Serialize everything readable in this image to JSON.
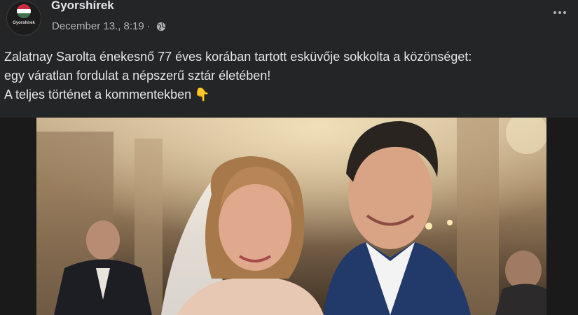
{
  "page": {
    "name": "Gyorshírek",
    "avatar_label": "Gyorshirek"
  },
  "post_meta": {
    "date": "December 13., 8:19",
    "separator": "·",
    "visibility_icon": "globe-icon"
  },
  "menu": {
    "icon": "more-options-icon"
  },
  "post": {
    "lines": [
      "Zalatnay Sarolta énekesnő 77 éves korában tartott esküvője sokkolta a közönséget:",
      "egy váratlan fordulat a népszerű sztár életében!",
      "A teljes történet a kommentekben"
    ],
    "emoji": "👇"
  },
  "colors": {
    "background": "#242526",
    "text_primary": "#e4e6eb",
    "text_secondary": "#b0b3b8"
  }
}
